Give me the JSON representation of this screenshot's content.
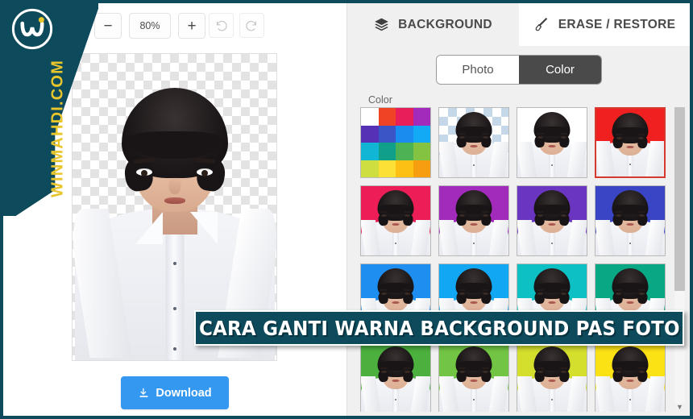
{
  "watermark": {
    "site": "WINMAHDI.COM",
    "logo_icon": "w-dot-logo-icon",
    "brand_color": "#0d4a5c",
    "text_color": "#e8c52a"
  },
  "banner": {
    "text": "CARA GANTI WARNA BACKGROUND PAS FOTO",
    "bg_color": "#0d4a5c",
    "text_color": "#ffffff"
  },
  "toolbar": {
    "zoom_out_label": "−",
    "zoom_level": "80%",
    "zoom_in_label": "+",
    "undo_icon": "undo-arrow-icon",
    "redo_icon": "redo-arrow-icon"
  },
  "canvas": {
    "background": "transparent-checkerboard",
    "subject": "portrait-photo"
  },
  "download": {
    "label": "Download",
    "icon": "download-icon",
    "color": "#3498f0"
  },
  "panel": {
    "tabs": [
      {
        "label": "BACKGROUND",
        "icon": "layers-icon",
        "active": true
      },
      {
        "label": "ERASE / RESTORE",
        "icon": "brush-icon",
        "active": false
      }
    ],
    "mode_toggle": {
      "options": [
        {
          "label": "Photo",
          "active": false
        },
        {
          "label": "Color",
          "active": true
        }
      ]
    },
    "color_section_label": "Color",
    "picker_swatch": {
      "name": "color-picker-palette",
      "rows": [
        [
          "#ffffff",
          "#f04326",
          "#e81e5b",
          "#a32bbb"
        ],
        [
          "#5630b5",
          "#3a55c6",
          "#1a8cf0",
          "#12a9f5"
        ],
        [
          "#11b6d4",
          "#10a08a",
          "#4cb253",
          "#83c341"
        ],
        [
          "#cede3e",
          "#fde035",
          "#fcc015",
          "#f79d10"
        ]
      ]
    },
    "swatches": [
      {
        "name": "transparent",
        "color": "transparent",
        "selected": false
      },
      {
        "name": "white",
        "color": "#ffffff",
        "selected": false
      },
      {
        "name": "red",
        "color": "#f02020",
        "selected": true
      },
      {
        "name": "crimson-pink",
        "color": "#ed1d58",
        "selected": false
      },
      {
        "name": "magenta-purple",
        "color": "#a32bbb",
        "selected": false
      },
      {
        "name": "purple",
        "color": "#6a35c0",
        "selected": false
      },
      {
        "name": "indigo-blue",
        "color": "#3a45c6",
        "selected": false
      },
      {
        "name": "blue",
        "color": "#1e8ef0",
        "selected": false
      },
      {
        "name": "light-blue",
        "color": "#11a7f2",
        "selected": false
      },
      {
        "name": "cyan",
        "color": "#0dc0c4",
        "selected": false
      },
      {
        "name": "teal-green",
        "color": "#09a884",
        "selected": false
      },
      {
        "name": "green",
        "color": "#4cb03e",
        "selected": false
      },
      {
        "name": "light-green",
        "color": "#72c544",
        "selected": false
      },
      {
        "name": "lime-yellow",
        "color": "#d3de2d",
        "selected": false
      },
      {
        "name": "yellow",
        "color": "#fbe215",
        "selected": false
      }
    ],
    "scroll_arrow_icon": "chevron-down-icon"
  }
}
